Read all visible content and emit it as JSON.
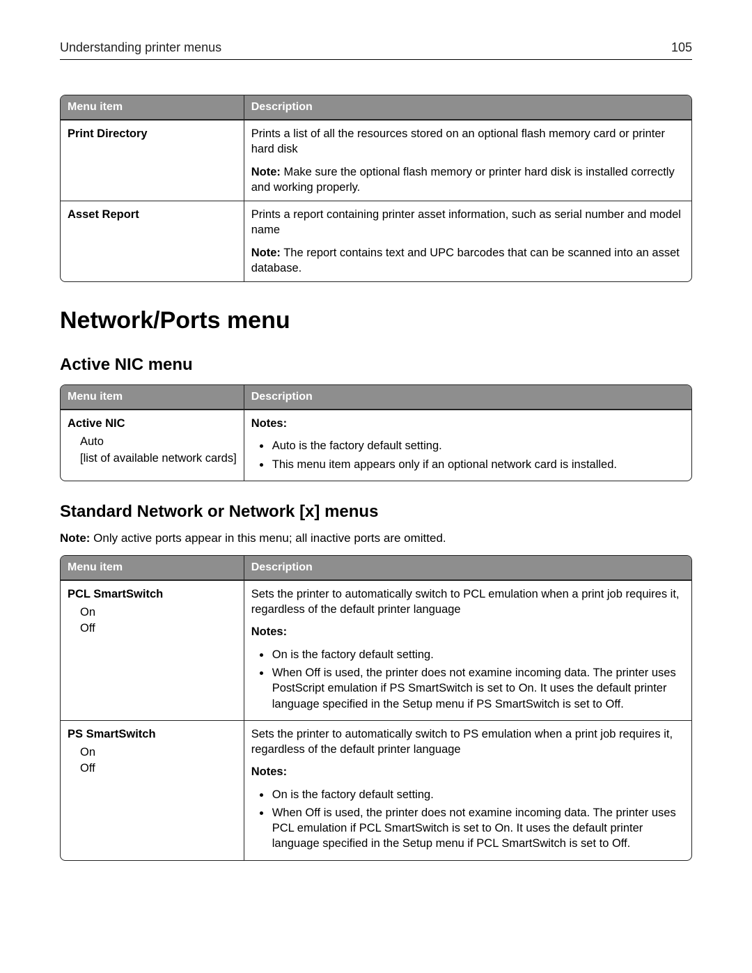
{
  "header": {
    "breadcrumb": "Understanding printer menus",
    "page_number": "105"
  },
  "table1_header": {
    "col1": "Menu item",
    "col2": "Description"
  },
  "table1": [
    {
      "menu_title": "Print Directory",
      "options": [],
      "desc_main": "Prints a list of all the resources stored on an optional flash memory card or printer hard disk",
      "note_label": "Note:",
      "note_text": " Make sure the optional flash memory or printer hard disk is installed correctly and working properly."
    },
    {
      "menu_title": "Asset Report",
      "options": [],
      "desc_main": "Prints a report containing printer asset information, such as serial number and model name",
      "note_label": "Note:",
      "note_text": " The report contains text and UPC barcodes that can be scanned into an asset database."
    }
  ],
  "section_title": "Network/Ports menu",
  "active_nic": {
    "heading": "Active NIC menu",
    "header": {
      "col1": "Menu item",
      "col2": "Description"
    },
    "row": {
      "menu_title": "Active NIC",
      "options": [
        "Auto",
        "[list of available network cards]"
      ],
      "notes_label": "Notes:",
      "bullets": [
        "Auto is the factory default setting.",
        "This menu item appears only if an optional network card is installed."
      ]
    }
  },
  "std_net": {
    "heading": "Standard Network or Network [x] menus",
    "intro_label": "Note:",
    "intro_text": " Only active ports appear in this menu; all inactive ports are omitted.",
    "header": {
      "col1": "Menu item",
      "col2": "Description"
    },
    "rows": [
      {
        "menu_title": "PCL SmartSwitch",
        "options": [
          "On",
          "Off"
        ],
        "desc_main": "Sets the printer to automatically switch to PCL emulation when a print job requires it, regardless of the default printer language",
        "notes_label": "Notes:",
        "bullets": [
          "On is the factory default setting.",
          "When Off is used, the printer does not examine incoming data. The printer uses PostScript emulation if PS SmartSwitch is set to On. It uses the default printer language specified in the Setup menu if PS SmartSwitch is set to Off."
        ]
      },
      {
        "menu_title": "PS SmartSwitch",
        "options": [
          "On",
          "Off"
        ],
        "desc_main": "Sets the printer to automatically switch to PS emulation when a print job requires it, regardless of the default printer language",
        "notes_label": "Notes:",
        "bullets": [
          "On is the factory default setting.",
          "When Off is used, the printer does not examine incoming data. The printer uses PCL emulation if PCL SmartSwitch is set to On. It uses the default printer language specified in the Setup menu if PCL SmartSwitch is set to Off."
        ]
      }
    ]
  }
}
